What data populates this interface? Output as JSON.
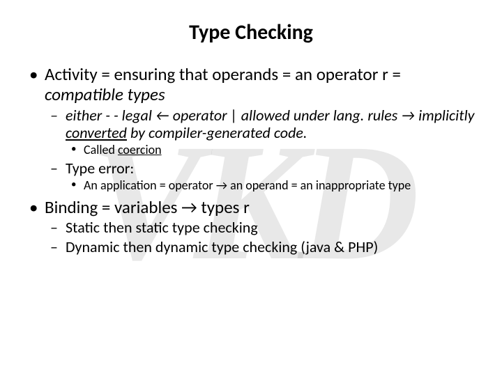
{
  "watermark": "VKD",
  "title": "Type Checking",
  "b1": {
    "line": "Activity = ensuring that operands = an operator r = ",
    "ital": "compatible types",
    "sub1_a": "either - - legal ",
    "sub1_arrowL": "←",
    "sub1_b": " operator | allowed under lang. rules ",
    "sub1_arrowR": "→",
    "sub1_c": " implicitly ",
    "sub1_conv": "converted",
    "sub1_d": " by compiler-generated code.",
    "sub1_note_a": "Called ",
    "sub1_note_b": "coercion",
    "sub2": "Type error:",
    "sub2_note_a": "An application = operator ",
    "sub2_arrow": "→",
    "sub2_note_b": " an operand = an inappropriate type"
  },
  "b2": {
    "line_a": "Binding = variables ",
    "arrow": "→",
    "line_b": " types r",
    "sub1": "Static then static type checking",
    "sub2": "Dynamic then dynamic type checking (java & PHP)"
  }
}
